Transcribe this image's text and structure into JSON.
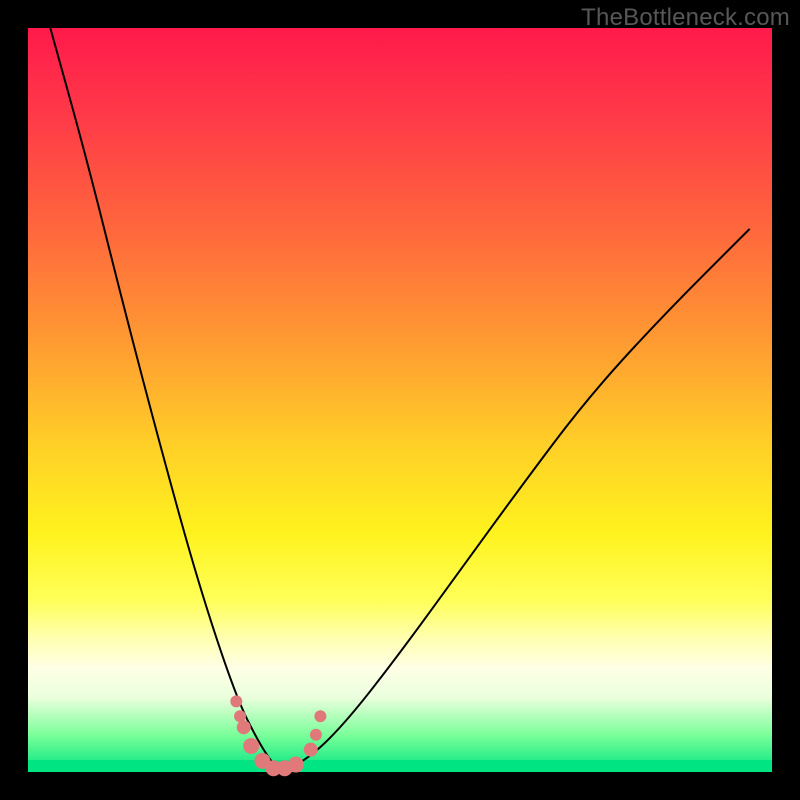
{
  "watermark": "TheBottleneck.com",
  "colors": {
    "background": "#000000",
    "gradient_top": "#ff1a4b",
    "gradient_bottom": "#00e582",
    "curve": "#000000",
    "markers": "#e07a7a"
  },
  "chart_data": {
    "type": "line",
    "title": "",
    "xlabel": "",
    "ylabel": "",
    "xlim": [
      0,
      1
    ],
    "ylim": [
      0,
      1
    ],
    "series": [
      {
        "name": "left-curve",
        "x": [
          0.03,
          0.08,
          0.13,
          0.18,
          0.23,
          0.28,
          0.31,
          0.33,
          0.34
        ],
        "y": [
          1.0,
          0.82,
          0.62,
          0.43,
          0.25,
          0.1,
          0.04,
          0.01,
          0.0
        ]
      },
      {
        "name": "right-curve",
        "x": [
          0.34,
          0.38,
          0.43,
          0.5,
          0.58,
          0.66,
          0.75,
          0.85,
          0.97
        ],
        "y": [
          0.0,
          0.02,
          0.07,
          0.16,
          0.27,
          0.38,
          0.5,
          0.61,
          0.73
        ]
      }
    ],
    "markers": {
      "name": "data-points",
      "x": [
        0.28,
        0.285,
        0.29,
        0.3,
        0.315,
        0.33,
        0.345,
        0.36,
        0.38,
        0.387,
        0.393
      ],
      "y": [
        0.095,
        0.075,
        0.06,
        0.035,
        0.015,
        0.005,
        0.005,
        0.01,
        0.03,
        0.05,
        0.075
      ],
      "r": [
        6,
        6,
        7,
        8,
        8,
        8,
        8,
        8,
        7,
        6,
        6
      ]
    }
  }
}
